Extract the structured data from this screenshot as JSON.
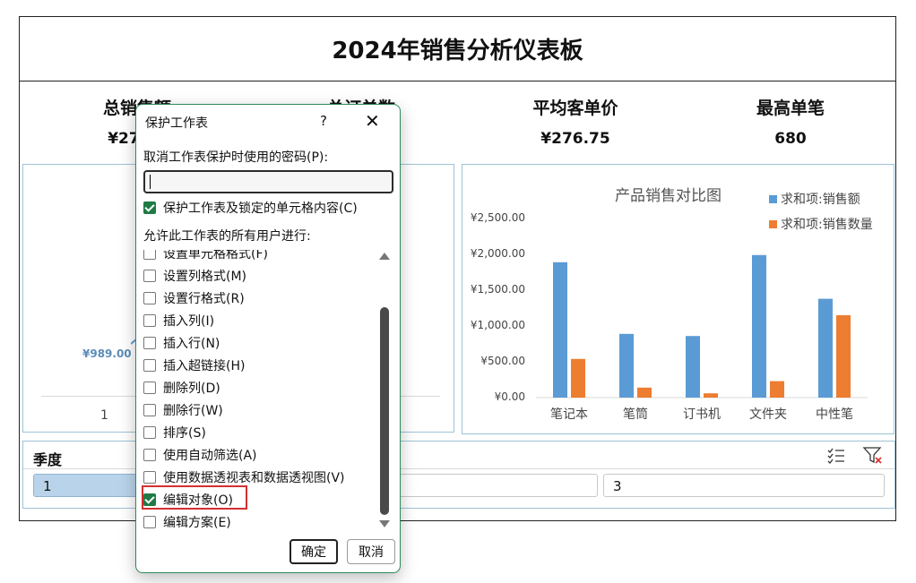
{
  "dashboard": {
    "title": "2024年销售分析仪表板",
    "kpis": [
      {
        "label": "总销售额",
        "value": "¥27,67"
      },
      {
        "label": "总订单数",
        "value": ""
      },
      {
        "label": "平均客单价",
        "value": "¥276.75"
      },
      {
        "label": "最高单笔",
        "value": "680"
      }
    ],
    "left_chart": {
      "annotation": "¥989.00",
      "x_label": "1"
    }
  },
  "chart_data": {
    "type": "bar",
    "title": "产品销售对比图",
    "categories": [
      "笔记本",
      "笔筒",
      "订书机",
      "文件夹",
      "中性笔"
    ],
    "series": [
      {
        "name": "求和项:销售额",
        "color": "#5b9bd5",
        "values": [
          1890,
          890,
          860,
          1990,
          1380
        ]
      },
      {
        "name": "求和项:销售数量",
        "color": "#ed7d31",
        "values": [
          540,
          140,
          60,
          230,
          1150
        ]
      }
    ],
    "yticks": [
      "¥2,500.00",
      "¥2,000.00",
      "¥1,500.00",
      "¥1,000.00",
      "¥500.00",
      "¥0.00"
    ],
    "ylim": [
      0,
      2500
    ],
    "legend_position": "top-right"
  },
  "slicer": {
    "title": "季度",
    "items": [
      "1",
      "",
      "3"
    ],
    "icons": [
      "multi-select-icon",
      "clear-filter-icon"
    ]
  },
  "dialog": {
    "title": "保护工作表",
    "help": "?",
    "close": "✕",
    "password_label": "取消工作表保护时使用的密码(P):",
    "password_value": "",
    "protect_label": "保护工作表及锁定的单元格内容(C)",
    "allow_label": "允许此工作表的所有用户进行:",
    "permissions": [
      {
        "label": "设置单元格格式(F)",
        "checked": false
      },
      {
        "label": "设置列格式(M)",
        "checked": false
      },
      {
        "label": "设置行格式(R)",
        "checked": false
      },
      {
        "label": "插入列(I)",
        "checked": false
      },
      {
        "label": "插入行(N)",
        "checked": false
      },
      {
        "label": "插入超链接(H)",
        "checked": false
      },
      {
        "label": "删除列(D)",
        "checked": false
      },
      {
        "label": "删除行(W)",
        "checked": false
      },
      {
        "label": "排序(S)",
        "checked": false
      },
      {
        "label": "使用自动筛选(A)",
        "checked": false
      },
      {
        "label": "使用数据透视表和数据透视图(V)",
        "checked": false
      },
      {
        "label": "编辑对象(O)",
        "checked": true
      },
      {
        "label": "编辑方案(E)",
        "checked": false
      }
    ],
    "ok": "确定",
    "cancel": "取消"
  }
}
